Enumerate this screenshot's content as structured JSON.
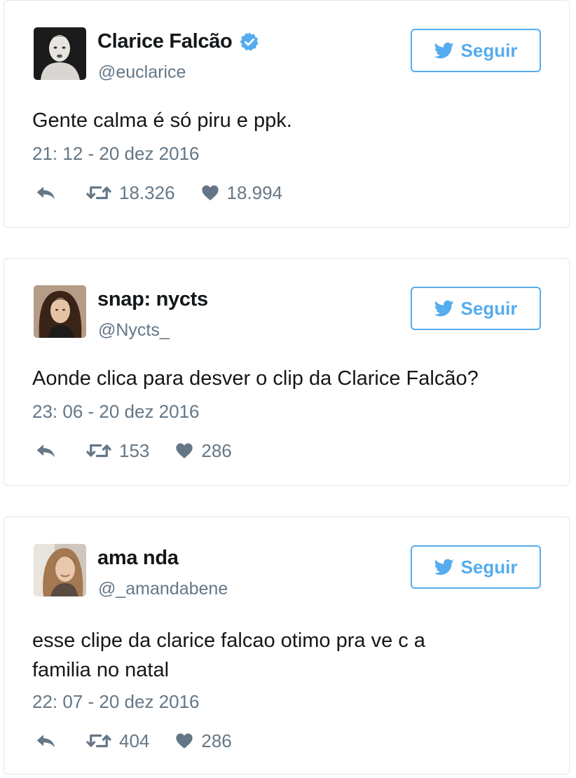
{
  "colors": {
    "twitter_blue": "#55acee",
    "text_primary": "#14171a",
    "text_secondary": "#657786",
    "border": "#e1e8ed"
  },
  "tweets": [
    {
      "name": "Clarice Falcão",
      "verified": true,
      "handle": "@euclarice",
      "follow_label": "Seguir",
      "text": "Gente calma é só piru e ppk.",
      "timestamp": "21: 12 - 20 dez 2016",
      "retweets": "18.326",
      "likes": "18.994",
      "icons": [
        "twitter-bird-icon",
        "verified-badge-icon",
        "reply-icon",
        "retweet-icon",
        "heart-icon"
      ]
    },
    {
      "name": "snap: nycts",
      "verified": false,
      "handle": "@Nycts_",
      "follow_label": "Seguir",
      "text": "Aonde clica para desver o clip da Clarice Falcão?",
      "timestamp": "23: 06 - 20 dez 2016",
      "retweets": "153",
      "likes": "286",
      "icons": [
        "twitter-bird-icon",
        "reply-icon",
        "retweet-icon",
        "heart-icon"
      ]
    },
    {
      "name": "ama nda",
      "verified": false,
      "handle": "@_amandabene",
      "follow_label": "Seguir",
      "text": "esse clipe da clarice falcao otimo pra ve c a familia no natal",
      "timestamp": "22: 07 - 20 dez 2016",
      "retweets": "404",
      "likes": "286",
      "icons": [
        "twitter-bird-icon",
        "reply-icon",
        "retweet-icon",
        "heart-icon"
      ]
    }
  ]
}
